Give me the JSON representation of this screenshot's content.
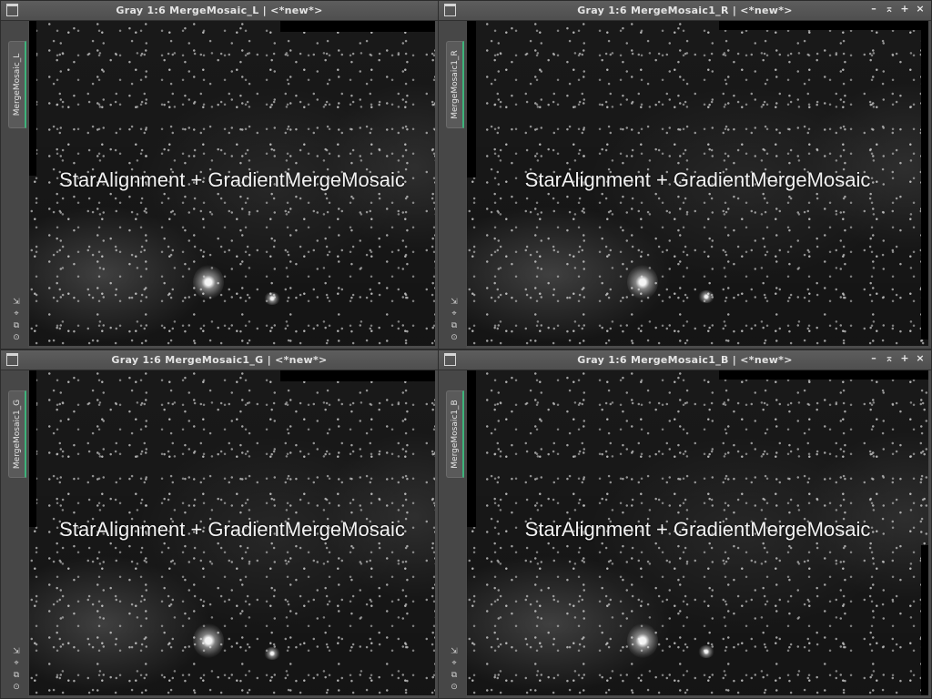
{
  "windows": [
    {
      "title": "Gray 1:6 MergeMosaic_L | <*new*>",
      "tab_label": "MergeMosaic_L",
      "show_controls": false,
      "overlay_text": "StarAlignment + GradientMergeMosaic"
    },
    {
      "title": "Gray 1:6 MergeMosaic1_R | <*new*>",
      "tab_label": "MergeMosaic1_R",
      "show_controls": true,
      "overlay_text": "StarAlignment + GradientMergeMosaic"
    },
    {
      "title": "Gray 1:6 MergeMosaic1_G | <*new*>",
      "tab_label": "MergeMosaic1_G",
      "show_controls": false,
      "overlay_text": "StarAlignment + GradientMergeMosaic"
    },
    {
      "title": "Gray 1:6 MergeMosaic1_B | <*new*>",
      "tab_label": "MergeMosaic1_B",
      "show_controls": true,
      "overlay_text": "StarAlignment + GradientMergeMosaic"
    }
  ],
  "title_controls": {
    "minimize": "–",
    "shade": "⌅",
    "maximize": "+",
    "close": "×"
  },
  "side_icons": {
    "fit": "⇲",
    "zoom": "⌖",
    "clone": "⧉",
    "settings": "⊙"
  },
  "icons": {
    "window": "window-icon",
    "minimize": "minimize-icon",
    "shade": "shade-icon",
    "maximize": "maximize-icon",
    "close": "close-icon"
  },
  "colors": {
    "tab_accent": "#3db37a",
    "titlebar": "#555555",
    "image_background": "#0d0d0d"
  }
}
